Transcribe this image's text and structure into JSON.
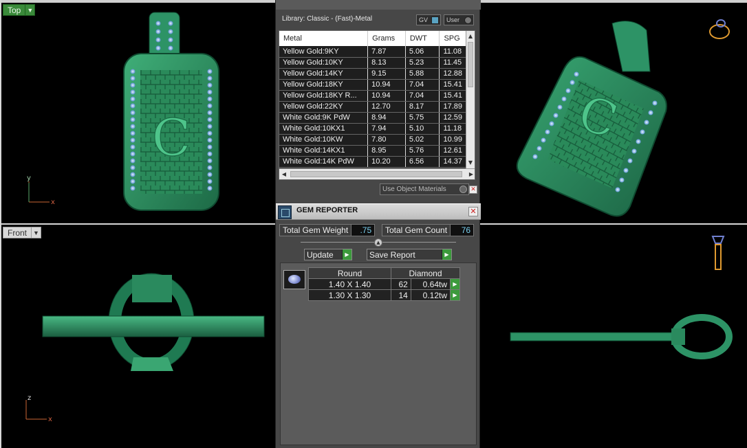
{
  "viewports": {
    "top": {
      "label": "Top",
      "axis_y": "y",
      "axis_x": "x"
    },
    "front": {
      "label": "Front",
      "axis_y": "z",
      "axis_x": "x"
    }
  },
  "pendant": {
    "letter": "C"
  },
  "library": {
    "title": "Library: Classic - (Fast)-Metal",
    "toggle_gv": "GV",
    "toggle_user": "User",
    "columns": [
      "Metal",
      "Grams",
      "DWT",
      "SPG"
    ],
    "rows": [
      [
        "Yellow Gold:9KY",
        "7.87",
        "5.06",
        "11.08"
      ],
      [
        "Yellow Gold:10KY",
        "8.13",
        "5.23",
        "11.45"
      ],
      [
        "Yellow Gold:14KY",
        "9.15",
        "5.88",
        "12.88"
      ],
      [
        "Yellow Gold:18KY",
        "10.94",
        "7.04",
        "15.41"
      ],
      [
        "Yellow Gold:18KY R...",
        "10.94",
        "7.04",
        "15.41"
      ],
      [
        "Yellow Gold:22KY",
        "12.70",
        "8.17",
        "17.89"
      ],
      [
        "White Gold:9K PdW",
        "8.94",
        "5.75",
        "12.59"
      ],
      [
        "White Gold:10KX1",
        "7.94",
        "5.10",
        "11.18"
      ],
      [
        "White Gold:10KW",
        "7.80",
        "5.02",
        "10.99"
      ],
      [
        "White Gold:14KX1",
        "8.95",
        "5.76",
        "12.61"
      ],
      [
        "White Gold:14K PdW",
        "10.20",
        "6.56",
        "14.37"
      ]
    ],
    "use_object_materials": "Use Object Materials"
  },
  "gem_reporter": {
    "title": "GEM REPORTER",
    "total_weight_label": "Total Gem Weight",
    "total_weight": ".75",
    "total_count_label": "Total Gem Count",
    "total_count": "76",
    "update_label": "Update",
    "save_label": "Save Report",
    "shape": "Round",
    "material": "Diamond",
    "rows": [
      {
        "size": "1.40 X 1.40",
        "count": "62",
        "weight": "0.64tw"
      },
      {
        "size": "1.30 X 1.30",
        "count": "14",
        "weight": "0.12tw"
      }
    ]
  },
  "colors": {
    "metal_green": "#2e8c5e",
    "gem_blue": "#8ab8e8",
    "accent_green": "#3c9a3c",
    "value_blue": "#7ad0f0"
  },
  "icons": [
    "ring-view-icon",
    "ring-side-icon",
    "gem-reporter-icon",
    "close-icon",
    "round-diamond-icon"
  ]
}
